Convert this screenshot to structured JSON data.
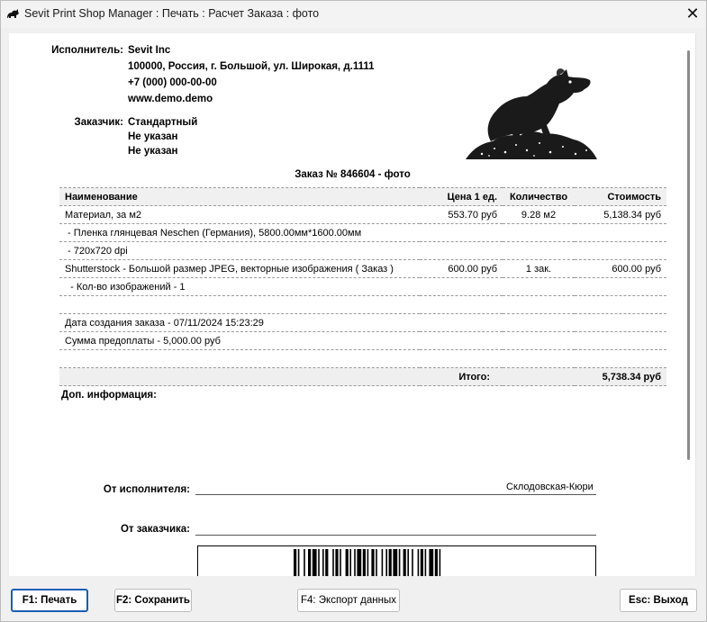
{
  "window": {
    "title": "Sevit Print Shop Manager : Печать : Расчет Заказа : фото",
    "close_label": "✕"
  },
  "executor": {
    "label": "Исполнитель:",
    "name": "Sevit Inc",
    "address": "100000, Россия, г. Большой, ул. Широкая, д.1111",
    "phone": "+7 (000) 000-00-00",
    "website": "www.demo.demo"
  },
  "customer": {
    "label": "Заказчик:",
    "name": "Стандартный",
    "line2": "Не указан",
    "line3": "Не указан"
  },
  "order": {
    "title": "Заказ № 846604 - фото"
  },
  "table": {
    "headers": {
      "name": "Наименование",
      "price": "Цена 1 ед.",
      "qty": "Количество",
      "cost": "Стоимость"
    },
    "rows": [
      {
        "name": "Материал, за м2",
        "price": "553.70 руб",
        "qty": "9.28 м2",
        "cost": "5,138.34 руб"
      },
      {
        "name": " - Пленка глянцевая Neschen (Германия), 5800.00мм*1600.00мм",
        "price": "",
        "qty": "",
        "cost": ""
      },
      {
        "name": " - 720x720 dpi",
        "price": "",
        "qty": "",
        "cost": ""
      },
      {
        "name": "Shutterstock - Большой размер JPEG, векторные изображения ( Заказ )",
        "price": "600.00 руб",
        "qty": "1 зак.",
        "cost": "600.00 руб"
      },
      {
        "name": "  - Кол-во изображений - 1",
        "price": "",
        "qty": "",
        "cost": ""
      },
      {
        "name": "",
        "price": "",
        "qty": "",
        "cost": ""
      },
      {
        "name": "Дата создания заказа - 07/11/2024 15:23:29",
        "price": "",
        "qty": "",
        "cost": ""
      },
      {
        "name": "Сумма предоплаты - 5,000.00 руб",
        "price": "",
        "qty": "",
        "cost": ""
      },
      {
        "name": "",
        "price": "",
        "qty": "",
        "cost": ""
      }
    ],
    "total_label": "Итого:",
    "total_value": "5,738.34 руб"
  },
  "extra_info_label": "Доп. информация:",
  "signatures": {
    "executor_label": "От исполнителя:",
    "executor_name": "Склодовская-Кюри",
    "customer_label": "От заказчика:"
  },
  "buttons": {
    "print": "F1: Печать",
    "save": "F2: Сохранить",
    "export": "F4: Экспорт данных",
    "exit": "Esc: Выход"
  },
  "icons": {
    "app": "rat-icon",
    "logo": "rat-logo-image",
    "close": "close-icon"
  },
  "colors": {
    "focus_border": "#1a5fb4",
    "header_bg": "#f0f0f0"
  }
}
